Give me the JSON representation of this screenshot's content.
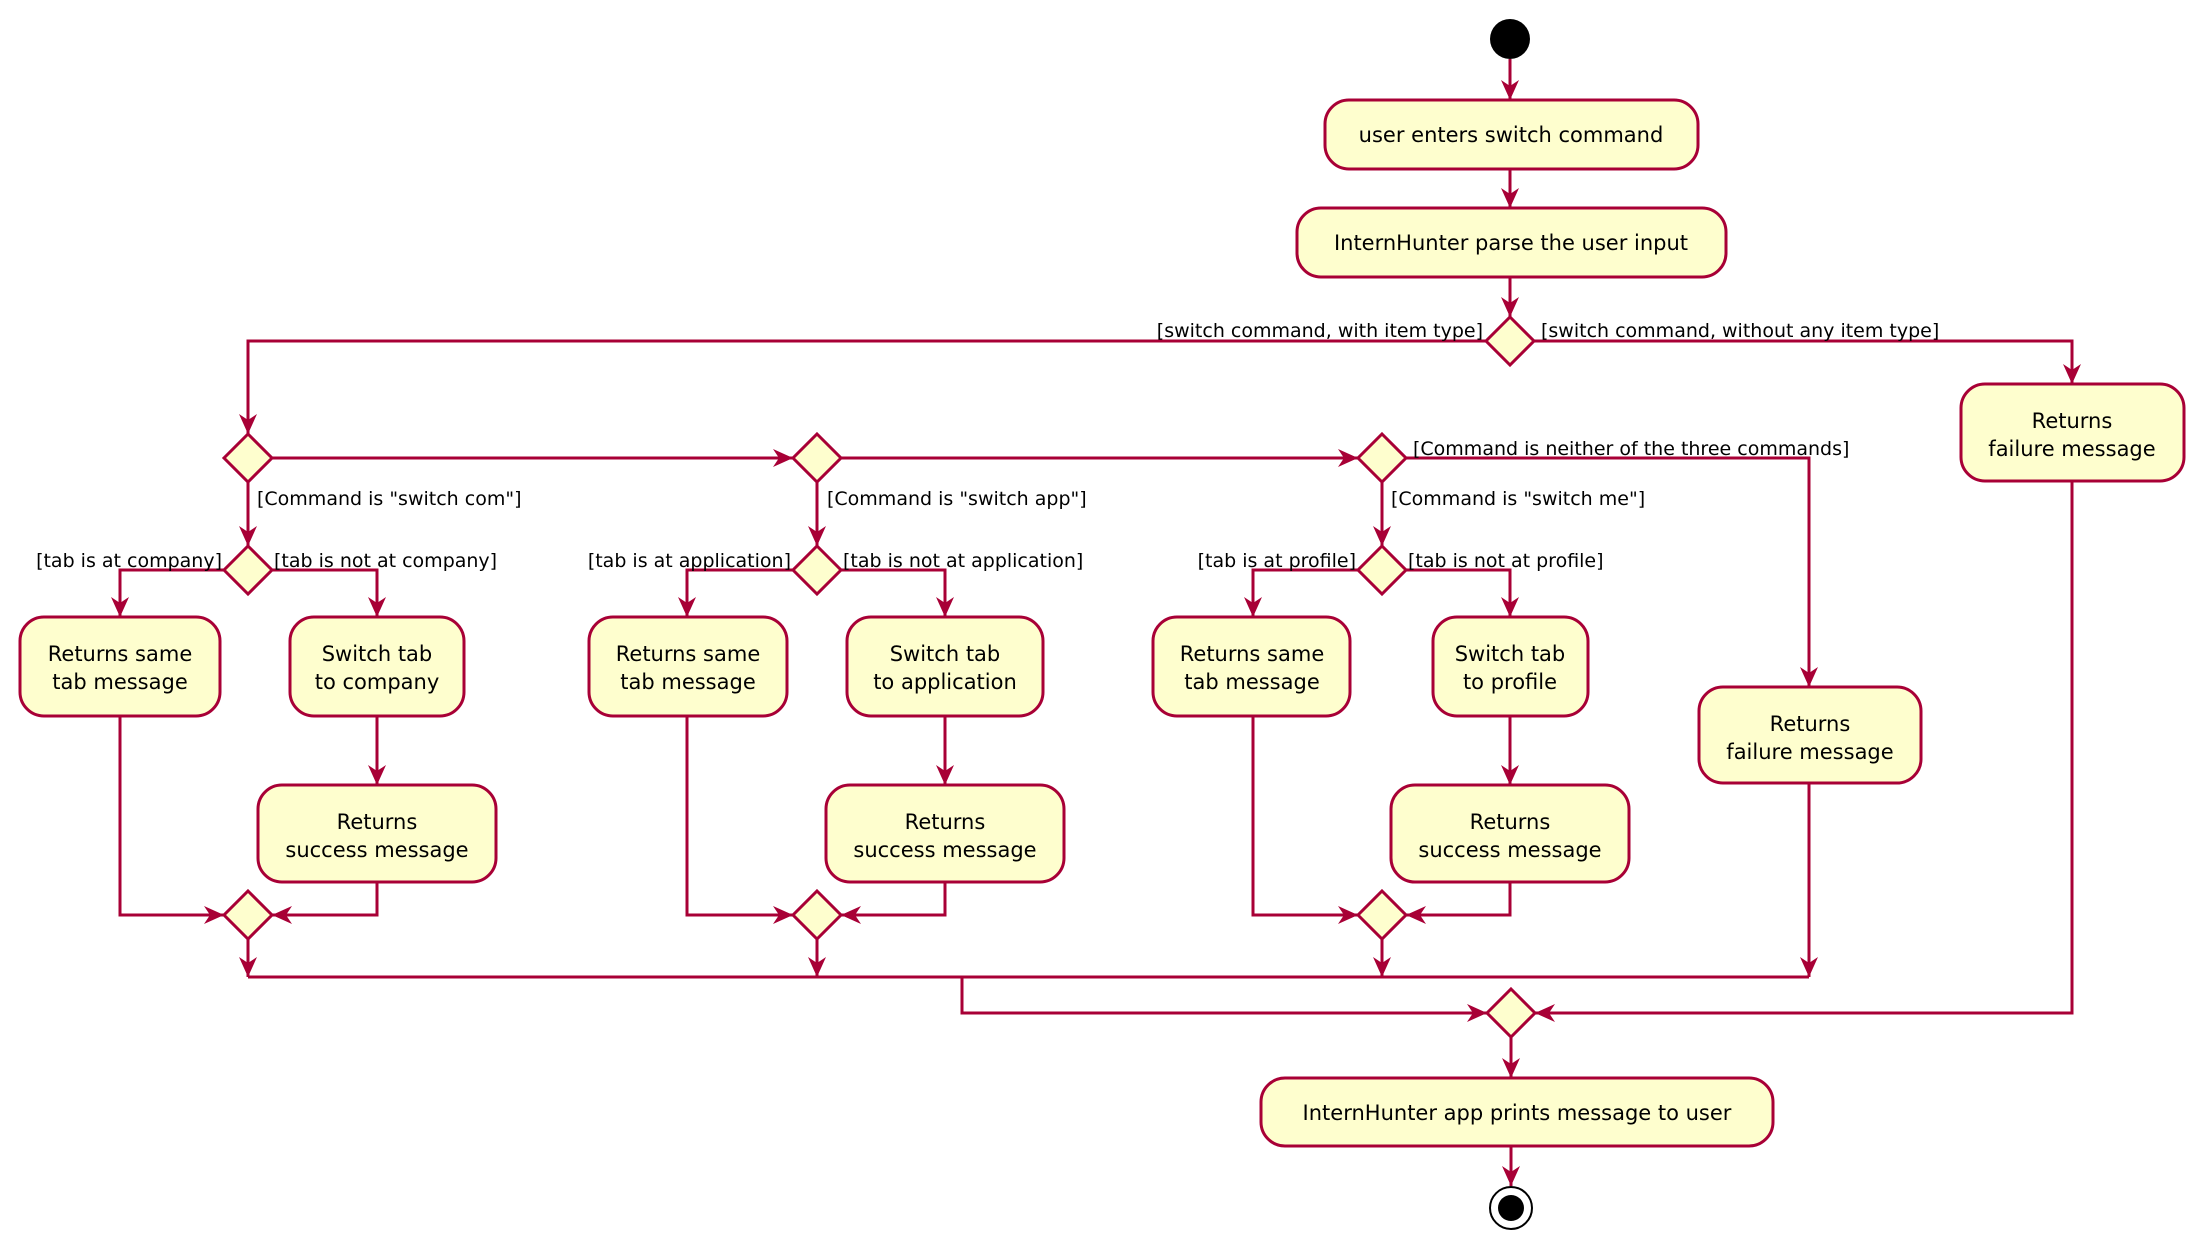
{
  "diagram": {
    "type": "activity",
    "colors": {
      "border": "#A80036",
      "fill": "#FEFECE",
      "text": "#000000"
    },
    "actions": {
      "enter": "user enters switch command",
      "parse": "InternHunter parse the user input",
      "fail_no_type": [
        "Returns",
        "failure message"
      ],
      "fail_neither": [
        "Returns",
        "failure message"
      ],
      "com_same": [
        "Returns same",
        "tab message"
      ],
      "com_switch": [
        "Switch tab",
        "to company"
      ],
      "com_success": [
        "Returns",
        "success message"
      ],
      "app_same": [
        "Returns same",
        "tab message"
      ],
      "app_switch": [
        "Switch tab",
        "to application"
      ],
      "app_success": [
        "Returns",
        "success message"
      ],
      "me_same": [
        "Returns same",
        "tab message"
      ],
      "me_switch": [
        "Switch tab",
        "to profile"
      ],
      "me_success": [
        "Returns",
        "success message"
      ],
      "print": "InternHunter app prints message to user"
    },
    "guards": {
      "with_type": "[switch command, with item type]",
      "without_type": "[switch command, without any item type]",
      "is_com": "[Command is \"switch com\"]",
      "is_app": "[Command is \"switch app\"]",
      "is_me": "[Command is \"switch me\"]",
      "neither": "[Command is neither of the three commands]",
      "at_company": "[tab is at company]",
      "not_company": "[tab is not at company]",
      "at_application": "[tab is at application]",
      "not_application": "[tab is not at application]",
      "at_profile": "[tab is at profile]",
      "not_profile": "[tab is not at profile]"
    }
  }
}
